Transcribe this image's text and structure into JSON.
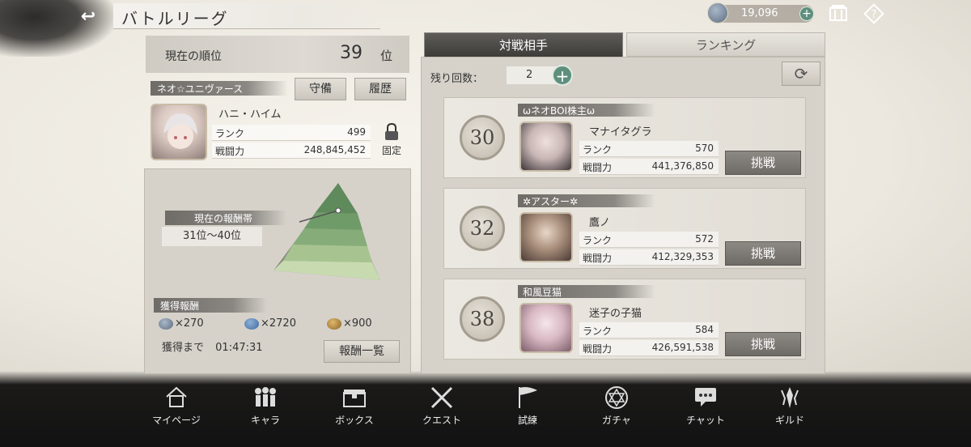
{
  "header": {
    "title": "バトルリーグ",
    "currency_amount": "19,096",
    "back_glyph": "↩"
  },
  "player": {
    "rank_label": "現在の順位",
    "rank_value": "39",
    "rank_unit": "位",
    "guild_name": "ネオ☆ユニヴァース",
    "defense_button": "守備",
    "history_button": "履歴",
    "name": "ハニ・ハイム",
    "rank_key": "ランク",
    "rank_stat": "499",
    "power_key": "戦闘力",
    "power_stat": "248,845,452",
    "lock_label": "固定"
  },
  "reward": {
    "band_label": "現在の報酬帯",
    "band_value": "31位〜40位",
    "gain_label": "獲得報酬",
    "items": [
      {
        "icon": "crystal-icon",
        "amount": "×270"
      },
      {
        "icon": "blue-coin-icon",
        "amount": "×2720"
      },
      {
        "icon": "gold-ore-icon",
        "amount": "×900"
      }
    ],
    "until_label": "獲得まで",
    "until_time": "01:47:31",
    "list_button": "報酬一覧"
  },
  "tabs": {
    "opponents": "対戦相手",
    "ranking": "ランキング"
  },
  "battle": {
    "remain_label": "残り回数：",
    "remain_value": "2"
  },
  "opponents": [
    {
      "level": "30",
      "guild": "ωネオBOI株主ω",
      "name": "マナイタグラ",
      "rank_key": "ランク",
      "rank": "570",
      "power_key": "戦闘力",
      "power": "441,376,850",
      "button": "挑戦"
    },
    {
      "level": "32",
      "guild": "✲アスター✲",
      "name": "鷹ノ",
      "rank_key": "ランク",
      "rank": "572",
      "power_key": "戦闘力",
      "power": "412,329,353",
      "button": "挑戦"
    },
    {
      "level": "38",
      "guild": "和風豆猫",
      "name": "迷子の子猫",
      "rank_key": "ランク",
      "rank": "584",
      "power_key": "戦闘力",
      "power": "426,591,538",
      "button": "挑戦"
    }
  ],
  "nav": [
    {
      "icon": "home-icon",
      "label": "マイページ"
    },
    {
      "icon": "characters-icon",
      "label": "キャラ"
    },
    {
      "icon": "box-icon",
      "label": "ボックス"
    },
    {
      "icon": "crossed-swords-icon",
      "label": "クエスト"
    },
    {
      "icon": "flag-icon",
      "label": "試練"
    },
    {
      "icon": "hexagram-icon",
      "label": "ガチャ"
    },
    {
      "icon": "chat-icon",
      "label": "チャット"
    },
    {
      "icon": "guild-emblem-icon",
      "label": "ギルド"
    }
  ]
}
